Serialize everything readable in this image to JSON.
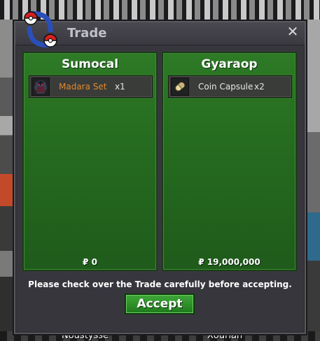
{
  "window": {
    "title": "Trade",
    "close_glyph": "✕"
  },
  "left_panel": {
    "player_name": "Sumocal",
    "items": [
      {
        "name": "Madara Set",
        "quantity": "x1",
        "icon": "outfit-icon",
        "name_color": "#e0892c"
      }
    ],
    "money": "₽ 0"
  },
  "right_panel": {
    "player_name": "Gyaraop",
    "items": [
      {
        "name": "Coin Capsule",
        "quantity": "x2",
        "icon": "coin-capsule-icon",
        "name_color": "#e6e6e6"
      }
    ],
    "money": "₽ 19,000,000"
  },
  "notice": "Please check over the Trade carefully before accepting.",
  "accept_label": "Accept",
  "background": {
    "name_left": "Noustysse",
    "name_right": "Xourian"
  },
  "colors": {
    "panel_green": "#256a1f",
    "accept_green": "#2f9229",
    "dialog_bg": "#37363d"
  }
}
